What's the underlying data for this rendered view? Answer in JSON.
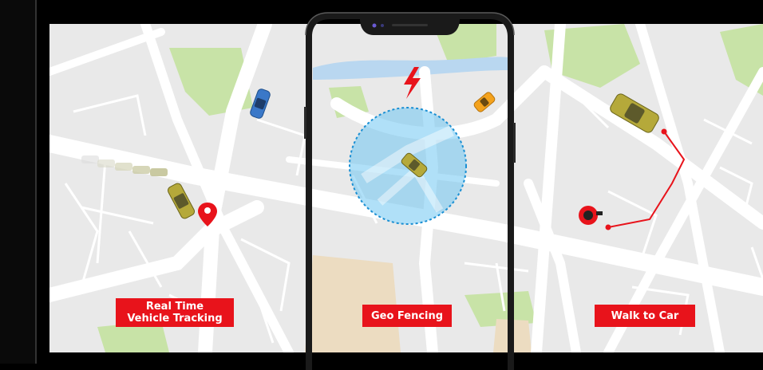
{
  "features": {
    "tracking": {
      "line1": "Real Time",
      "line2": "Vehicle Tracking",
      "pin_icon": "map-pin-icon",
      "color": "#e8131b"
    },
    "geofence": {
      "label": "Geo Fencing",
      "alert_icon": "lightning-icon",
      "zone_color": "#6fc6f2"
    },
    "walk": {
      "label": "Walk to Car",
      "route_color": "#e8131b"
    }
  },
  "colors": {
    "map_bg": "#e9e9e9",
    "road": "#ffffff",
    "park": "#c8e3a7",
    "water": "#b9d7f0",
    "sand": "#ecdcc1",
    "label_bg": "#e8131b"
  }
}
